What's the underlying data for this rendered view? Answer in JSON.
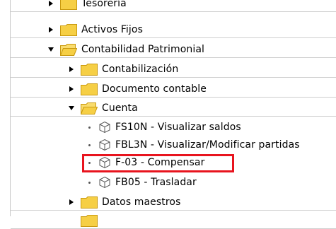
{
  "tree": {
    "items": [
      {
        "label": "Tesorería",
        "type": "folder",
        "state": "collapsed",
        "level": 0
      },
      {
        "label": "Activos Fijos",
        "type": "folder",
        "state": "collapsed",
        "level": 0
      },
      {
        "label": "Contabilidad Patrimonial",
        "type": "folder",
        "state": "expanded",
        "level": 0
      },
      {
        "label": "Contabilización",
        "type": "folder",
        "state": "collapsed",
        "level": 1
      },
      {
        "label": "Documento contable",
        "type": "folder",
        "state": "collapsed",
        "level": 1
      },
      {
        "label": "Cuenta",
        "type": "folder",
        "state": "expanded",
        "level": 1
      },
      {
        "label": "FS10N - Visualizar saldos",
        "type": "transaction",
        "level": 2
      },
      {
        "label": "FBL3N - Visualizar/Modificar partidas",
        "type": "transaction",
        "level": 2
      },
      {
        "label": "F-03 - Compensar",
        "type": "transaction",
        "level": 2,
        "highlighted": true
      },
      {
        "label": "FB05 - Trasladar",
        "type": "transaction",
        "level": 2
      },
      {
        "label": "Datos maestros",
        "type": "folder",
        "state": "collapsed",
        "level": 1
      }
    ]
  },
  "colors": {
    "folder_fill": "#f6cf45",
    "folder_edge": "#c99a10",
    "highlight": "#e8141e",
    "row_separator": "#cfcfcf"
  }
}
